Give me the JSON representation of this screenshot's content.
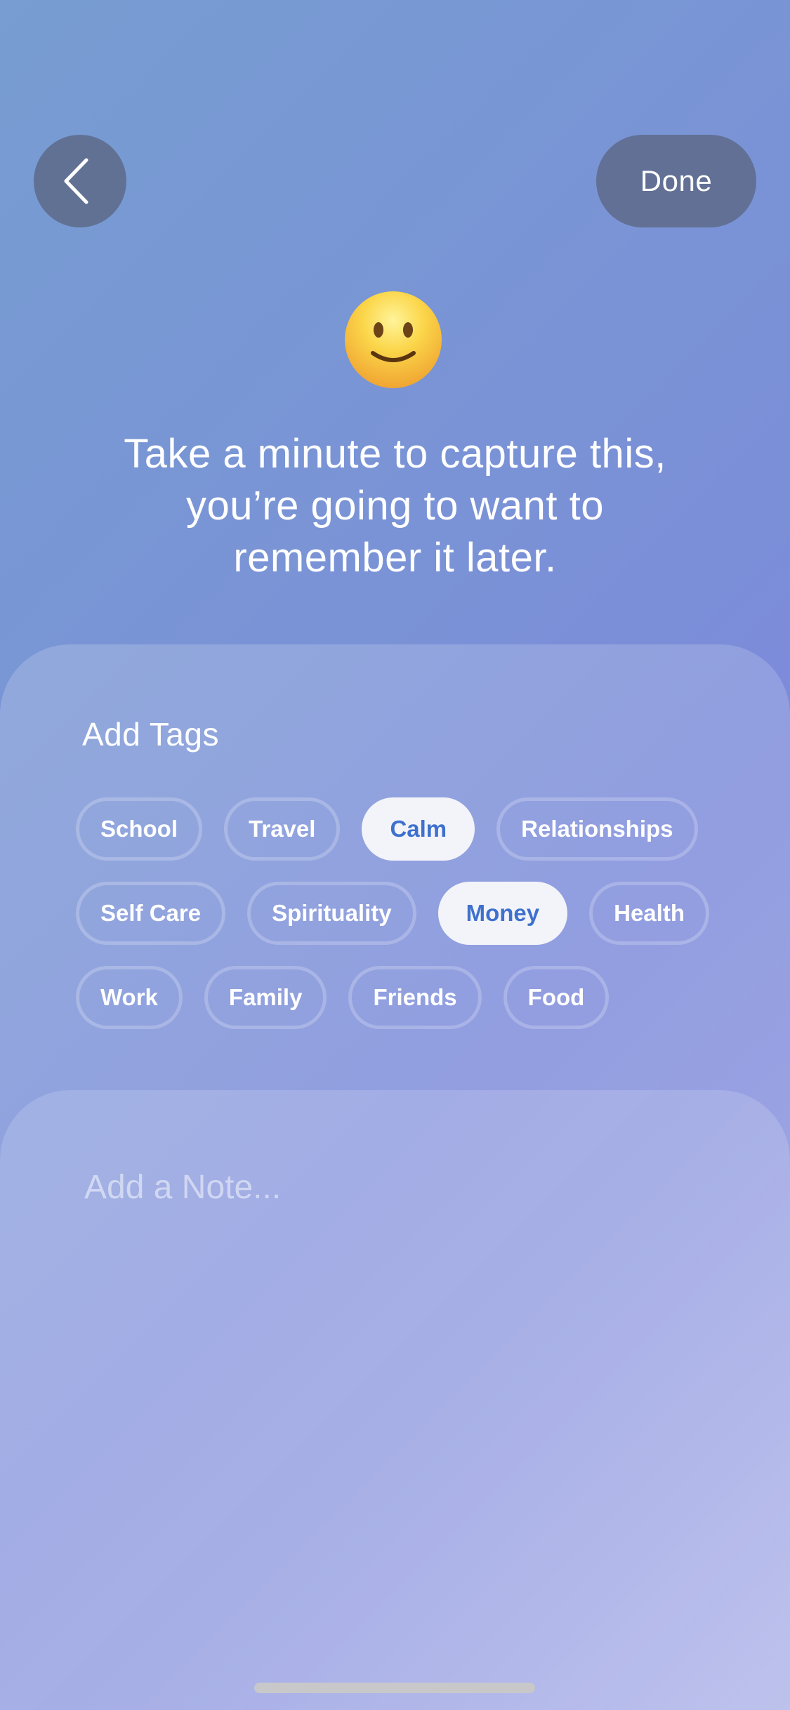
{
  "header": {
    "back_icon": "chevron-left-icon",
    "done_label": "Done"
  },
  "mood": {
    "emoji": "🙂",
    "emoji_name": "slightly-smiling-face"
  },
  "prompt": {
    "lines": [
      "Take a minute to capture this,",
      "you’re going to want to",
      "remember it later."
    ]
  },
  "tags": {
    "title": "Add Tags",
    "rows": [
      [
        {
          "label": "School",
          "selected": false
        },
        {
          "label": "Travel",
          "selected": false
        },
        {
          "label": "Calm",
          "selected": true
        },
        {
          "label": "Relationships",
          "selected": false
        }
      ],
      [
        {
          "label": "Self Care",
          "selected": false
        },
        {
          "label": "Spirituality",
          "selected": false
        },
        {
          "label": "Money",
          "selected": true
        },
        {
          "label": "Health",
          "selected": false
        }
      ],
      [
        {
          "label": "Work",
          "selected": false
        },
        {
          "label": "Family",
          "selected": false
        },
        {
          "label": "Friends",
          "selected": false
        },
        {
          "label": "Food",
          "selected": false
        }
      ]
    ]
  },
  "note": {
    "value": "",
    "placeholder": "Add a Note..."
  },
  "colors": {
    "accent": "#3e71cd",
    "button_bg": "#617094",
    "selected_chip_bg": "#f3f4fa"
  }
}
